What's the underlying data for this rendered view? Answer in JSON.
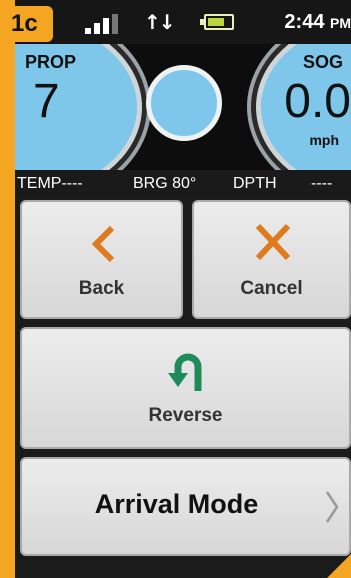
{
  "step_badge": "1c",
  "status": {
    "time": "2:44",
    "ampm": "PM"
  },
  "gauges": {
    "prop_label": "PROP",
    "prop_value": "7",
    "sog_label": "SOG",
    "sog_value": "0.0",
    "sog_unit": "mph"
  },
  "data_strip": {
    "temp": "TEMP----",
    "brg": "BRG 80°",
    "dpth_label": "DPTH",
    "dpth_value": "----"
  },
  "buttons": {
    "back": "Back",
    "cancel": "Cancel",
    "reverse": "Reverse",
    "arrival": "Arrival Mode"
  },
  "colors": {
    "accent": "#f4a522",
    "gauge_blue": "#7fc7ea",
    "back_orange": "#e07a1e",
    "reverse_green": "#1f8a5a"
  }
}
